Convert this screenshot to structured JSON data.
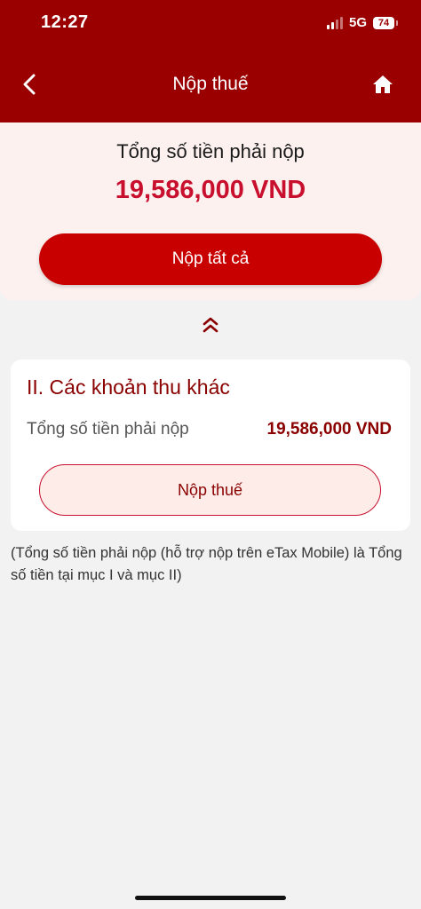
{
  "status_bar": {
    "time": "12:27",
    "network": "5G",
    "battery": "74"
  },
  "header": {
    "title": "Nộp thuế",
    "back_icon": "chevron-left-icon",
    "home_icon": "home-icon",
    "background_color": "#9b0000"
  },
  "summary": {
    "label": "Tổng số tiền phải nộp",
    "amount": "19,586,000 VND",
    "pay_all_label": "Nộp tất cả",
    "accent_color": "#c8102e"
  },
  "collapse_icon": "double-chevron-up-icon",
  "section": {
    "title": "II. Các khoản thu khác",
    "total_label": "Tổng số tiền phải nộp",
    "total_amount": "19,586,000 VND",
    "pay_label": "Nộp thuế"
  },
  "footnote": "(Tổng số tiền phải nộp (hỗ trợ nộp trên eTax Mobile) là Tổng số tiền tại mục I và mục II)"
}
